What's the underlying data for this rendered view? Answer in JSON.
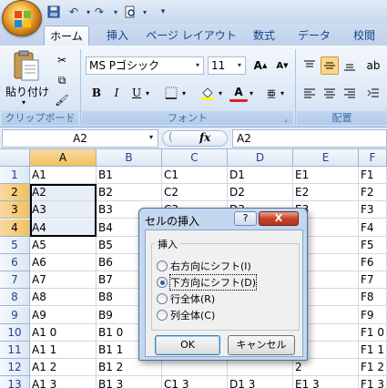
{
  "title_bar": {
    "qat_icons": [
      "save-icon",
      "undo-icon",
      "redo-icon",
      "print-preview-icon",
      "customize-icon"
    ]
  },
  "ribbon_tabs": [
    {
      "label": "ホーム",
      "active": true
    },
    {
      "label": "挿入",
      "active": false
    },
    {
      "label": "ページ レイアウト",
      "active": false
    },
    {
      "label": "数式",
      "active": false
    },
    {
      "label": "データ",
      "active": false
    },
    {
      "label": "校閲",
      "active": false
    }
  ],
  "clipboard": {
    "paste_label": "貼り付け",
    "group_label": "クリップボード"
  },
  "font": {
    "name": "MS Pゴシック",
    "size": "11",
    "group_label": "フォント",
    "bold": "B",
    "italic": "I",
    "underline": "U"
  },
  "alignment": {
    "group_label": "配置"
  },
  "formula_bar": {
    "name_box": "A2",
    "fx": "fx",
    "content": "A2"
  },
  "columns": [
    "A",
    "B",
    "C",
    "D",
    "E",
    "F"
  ],
  "rows": [
    {
      "num": "1",
      "cells": [
        "A1",
        "B1",
        "C1",
        "D1",
        "E1",
        "F1"
      ]
    },
    {
      "num": "2",
      "cells": [
        "A2",
        "B2",
        "C2",
        "D2",
        "E2",
        "F2"
      ]
    },
    {
      "num": "3",
      "cells": [
        "A3",
        "B3",
        "C3",
        "D3",
        "E3",
        "F3"
      ]
    },
    {
      "num": "4",
      "cells": [
        "A4",
        "B4",
        "",
        "",
        "",
        "F4"
      ]
    },
    {
      "num": "5",
      "cells": [
        "A5",
        "B5",
        "",
        "",
        "",
        "F5"
      ]
    },
    {
      "num": "6",
      "cells": [
        "A6",
        "B6",
        "",
        "",
        "",
        "F6"
      ]
    },
    {
      "num": "7",
      "cells": [
        "A7",
        "B7",
        "",
        "",
        "",
        "F7"
      ]
    },
    {
      "num": "8",
      "cells": [
        "A8",
        "B8",
        "",
        "",
        "",
        "F8"
      ]
    },
    {
      "num": "9",
      "cells": [
        "A9",
        "B9",
        "",
        "",
        "",
        "F9"
      ]
    },
    {
      "num": "10",
      "cells": [
        "A1 0",
        "B1 0",
        "",
        "",
        "0",
        "F1 0"
      ]
    },
    {
      "num": "11",
      "cells": [
        "A1 1",
        "B1 1",
        "",
        "",
        "1",
        "F1 1"
      ]
    },
    {
      "num": "12",
      "cells": [
        "A1 2",
        "B1 2",
        "",
        "",
        "2",
        "F1 2"
      ]
    },
    {
      "num": "13",
      "cells": [
        "A1 3",
        "B1 3",
        "C1 3",
        "D1 3",
        "E1 3",
        "F1 3"
      ]
    }
  ],
  "dialog": {
    "title": "セルの挿入",
    "help": "?",
    "close": "X",
    "group": "挿入",
    "options": [
      {
        "label": "右方向にシフト(I)",
        "checked": false
      },
      {
        "label": "下方向にシフト(D)",
        "checked": true
      },
      {
        "label": "行全体(R)",
        "checked": false
      },
      {
        "label": "列全体(C)",
        "checked": false
      }
    ],
    "ok": "OK",
    "cancel": "キャンセル"
  }
}
